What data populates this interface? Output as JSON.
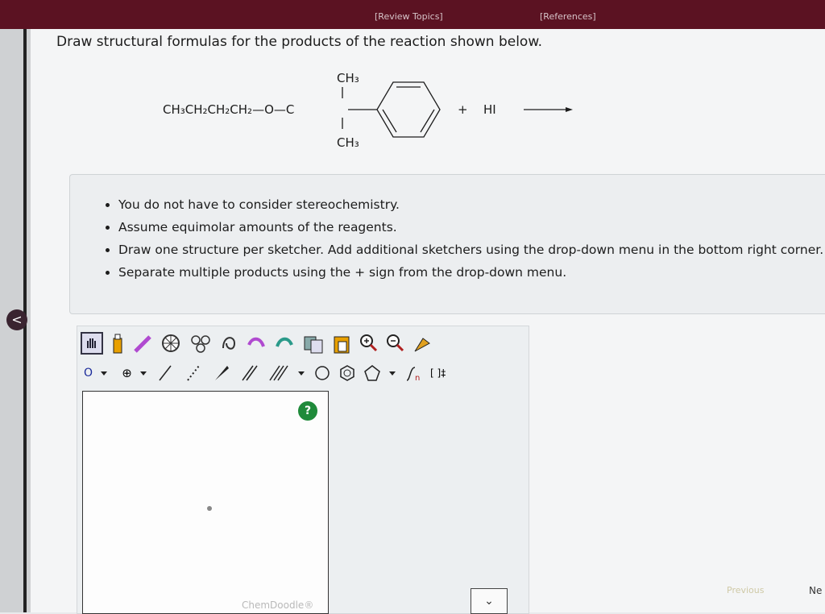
{
  "header": {
    "review_topics": "[Review Topics]",
    "references": "[References]"
  },
  "question": {
    "text": "Draw structural formulas for the products of the reaction shown below."
  },
  "reaction": {
    "chain": "CH₃CH₂CH₂CH₂—O—C",
    "methyl_top": "CH₃",
    "methyl_bottom": "CH₃",
    "plus": "+",
    "reagent": "HI"
  },
  "instructions": [
    "You do not have to consider stereochemistry.",
    "Assume equimolar amounts of the reagents.",
    "Draw one structure per sketcher. Add additional sketchers using the drop-down menu in the bottom right corner.",
    "Separate multiple products using the + sign from the drop-down menu."
  ],
  "sketcher": {
    "atom_label": "O",
    "charge_label": "⊕",
    "brackets_label": "[ ]‡",
    "help_label": "?",
    "brand": "ChemDoodle®",
    "dropdown_label": "⌄"
  },
  "nav": {
    "back_label": "<",
    "previous_label": "Previous",
    "next_label": "Ne"
  },
  "colors": {
    "header_bg": "#5b1222",
    "help_green": "#1f8a3a"
  }
}
